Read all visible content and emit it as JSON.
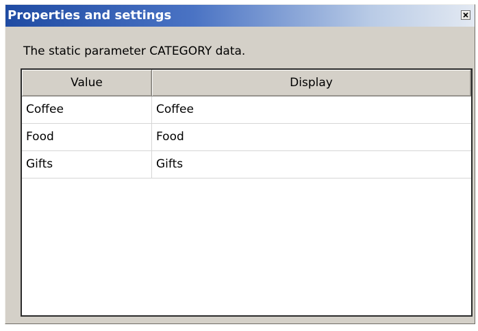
{
  "window": {
    "title": "Properties and settings"
  },
  "description": "The static parameter CATEGORY data.",
  "table": {
    "columns": [
      "Value",
      "Display"
    ],
    "rows": [
      [
        "Coffee",
        "Coffee"
      ],
      [
        "Food",
        "Food"
      ],
      [
        "Gifts",
        "Gifts"
      ]
    ]
  },
  "icons": {
    "close": "close-icon"
  },
  "colors": {
    "titlebar_start": "#1f4ba3",
    "titlebar_end": "#e3e9f2",
    "dialog_face": "#d4d0c8"
  }
}
